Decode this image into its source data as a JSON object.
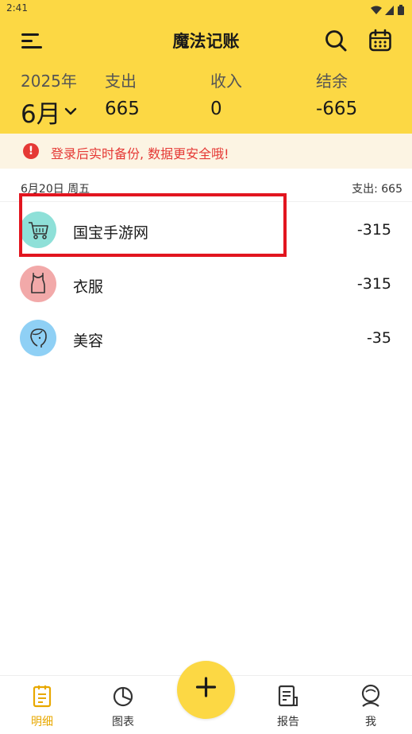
{
  "status_bar": {
    "time": "2:41"
  },
  "header": {
    "title": "魔法记账",
    "year_label": "2025年",
    "month_value": "6月",
    "expense_label": "支出",
    "expense_value": "665",
    "income_label": "收入",
    "income_value": "0",
    "balance_label": "结余",
    "balance_value": "-665"
  },
  "notice": {
    "icon": "!",
    "text": "登录后实时备份, 数据更安全哦!"
  },
  "day_group": {
    "date": "6月20日  周五",
    "total": "支出: 665"
  },
  "items": [
    {
      "name": "国宝手游网",
      "amount": "-315",
      "icon": "shopping-cart-icon",
      "color": "#8EE0D8"
    },
    {
      "name": "衣服",
      "amount": "-315",
      "icon": "shirt-icon",
      "color": "#F2A9A9"
    },
    {
      "name": "美容",
      "amount": "-35",
      "icon": "face-icon",
      "color": "#8FD0F5"
    }
  ],
  "nav": [
    {
      "label": "明细",
      "icon": "document-icon",
      "active": true
    },
    {
      "label": "图表",
      "icon": "pie-chart-icon",
      "active": false
    },
    {
      "label": "报告",
      "icon": "report-icon",
      "active": false
    },
    {
      "label": "我",
      "icon": "profile-icon",
      "active": false
    }
  ],
  "colors": {
    "accent": "#FCD844",
    "warning": "#E53935",
    "highlight": "#E2151F",
    "active_nav": "#E8A800"
  }
}
